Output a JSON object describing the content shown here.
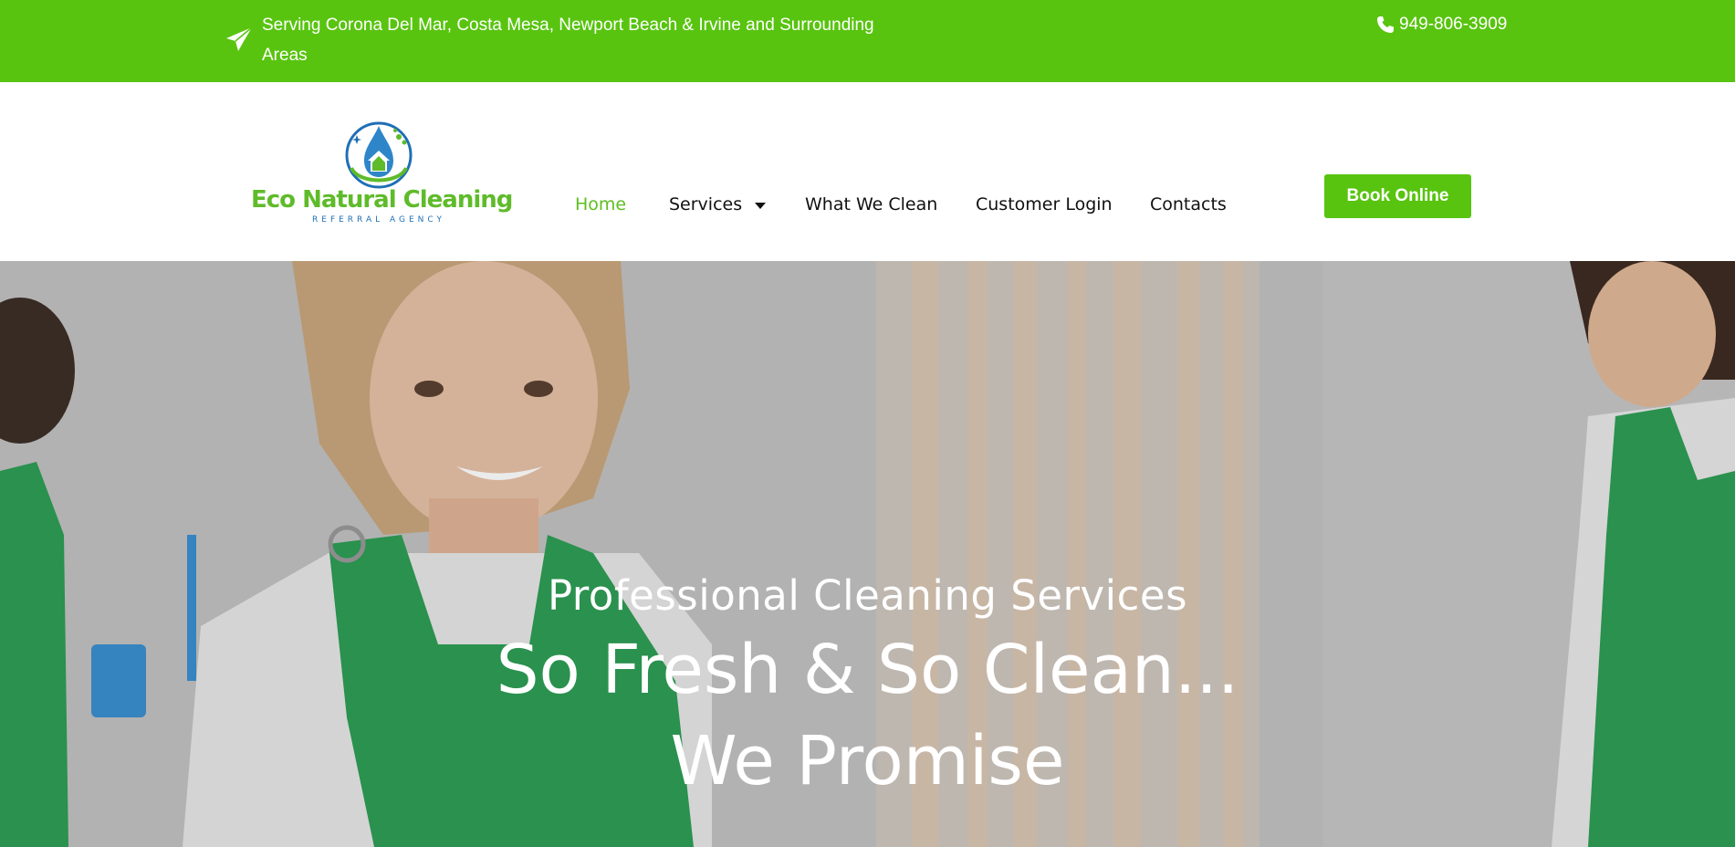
{
  "topbar": {
    "service_area": "Serving Corona Del Mar, Costa Mesa, Newport Beach & Irvine and Surrounding Areas",
    "phone": "949-806-3909",
    "send_icon": "paper-plane-icon",
    "phone_icon": "phone-icon",
    "background": "#58c40f"
  },
  "logo": {
    "name": "Eco Natural Cleaning",
    "tagline": "REFERRAL AGENCY"
  },
  "nav": {
    "items": [
      {
        "label": "Home",
        "active": true
      },
      {
        "label": "Services",
        "has_dropdown": true
      },
      {
        "label": "What We Clean"
      },
      {
        "label": "Customer Login"
      },
      {
        "label": "Contacts"
      }
    ],
    "active_color": "#5dbf1e"
  },
  "cta": {
    "label": "Book Online",
    "color": "#58c40f"
  },
  "hero": {
    "subtitle": "Professional Cleaning Services",
    "headline_line1": "So Fresh & So Clean...",
    "headline_line2": "We Promise"
  }
}
